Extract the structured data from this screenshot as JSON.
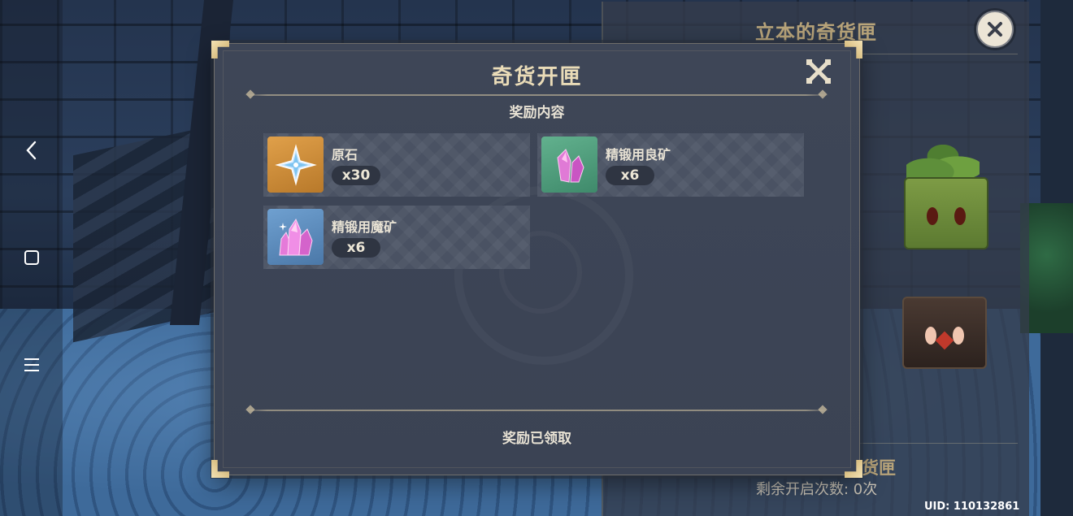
{
  "back_panel": {
    "title": "立本的奇货匣",
    "subtitle": "货匣",
    "remaining": "剩余开启次数: 0次"
  },
  "uid": "UID: 110132861",
  "dialog": {
    "title": "奇货开匣",
    "section_title": "奖励内容",
    "footer": "奖励已领取",
    "items": [
      {
        "name": "原石",
        "qty": "x30",
        "icon": "primogem-icon",
        "rarity_color": "#c98a33"
      },
      {
        "name": "精锻用良矿",
        "qty": "x6",
        "icon": "fine-enhancement-ore-icon",
        "rarity_color": "#4f9b7c"
      },
      {
        "name": "精锻用魔矿",
        "qty": "x6",
        "icon": "mystic-enhancement-ore-icon",
        "rarity_color": "#5a88b8"
      }
    ]
  },
  "system_bar": {
    "icons": [
      "back-icon",
      "square-icon",
      "menu-icon"
    ]
  },
  "colors": {
    "dialog_bg": "#3e4657",
    "title_gold": "#eadcb8",
    "accent_gold": "#c9a964"
  }
}
